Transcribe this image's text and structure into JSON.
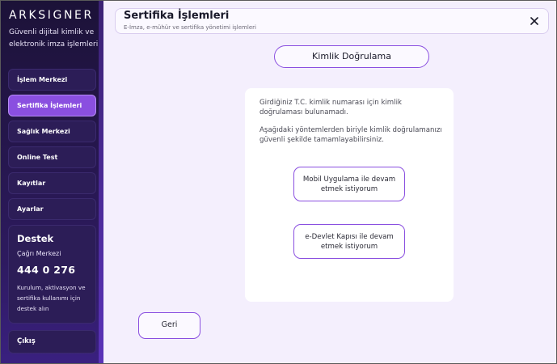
{
  "sidebar": {
    "logo": "ARKSIGNER",
    "tagline": "Güvenli dijital kimlik ve elektronik imza işlemleri",
    "items": [
      {
        "label": "İşlem Merkezi"
      },
      {
        "label": "Sertifika İşlemleri",
        "active": true
      },
      {
        "label": "Sağlık Merkezi"
      },
      {
        "label": "Online Test"
      },
      {
        "label": "Kayıtlar"
      },
      {
        "label": "Ayarlar"
      }
    ],
    "support": {
      "title": "Destek",
      "subtitle": "Çağrı Merkezi",
      "phone": "444 0 276",
      "description": "Kurulum, aktivasyon ve sertifika kullanımı için destek alın"
    },
    "logout_label": "Çıkış"
  },
  "header": {
    "title": "Sertifika İşlemleri",
    "subtitle": "E-İmza, e-mühür ve sertifika yönetimi işlemleri",
    "close_icon": "close-icon"
  },
  "main": {
    "section_title": "Kimlik Doğrulama",
    "message_line1": "Girdiğiniz T.C. kimlik numarası için kimlik doğrulaması bulunamadı.",
    "message_line2": "Aşağıdaki yöntemlerden biriyle kimlik doğrulamanızı güvenli şekilde tamamlayabilirsiniz.",
    "options": [
      {
        "label": "Mobil Uygulama ile devam etmek istiyorum"
      },
      {
        "label": "e-Devlet Kapısı ile devam etmek istiyorum"
      }
    ],
    "back_label": "Geri"
  },
  "colors": {
    "accent": "#8a4fe0",
    "sidebar_bg": "#24164a",
    "page_bg": "#f4effd"
  }
}
